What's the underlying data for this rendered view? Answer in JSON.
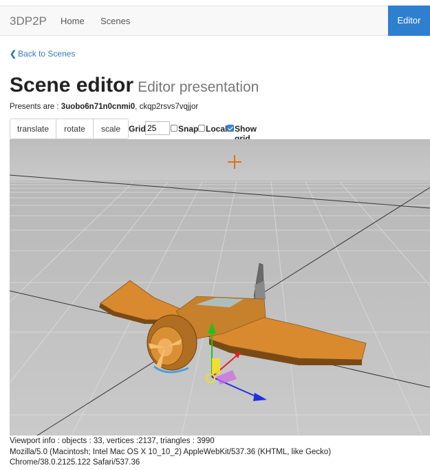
{
  "navbar": {
    "brand": "3DP2P",
    "links": [
      "Home",
      "Scenes"
    ],
    "active": "Editor",
    "colors": {
      "active_bg": "#2f7fd0"
    }
  },
  "back_link": {
    "icon": "chevron-left-icon",
    "label": "Back to Scenes"
  },
  "title": {
    "main": "Scene editor",
    "sub": "Editor presentation"
  },
  "presents": {
    "label": "Presents are : ",
    "items": [
      "3uobo6n71n0cnmi0",
      "ckqp2rsvs7vqjjor"
    ]
  },
  "toolbar": {
    "translate": "translate",
    "rotate": "rotate",
    "scale": "scale",
    "grid_label": "Grid",
    "grid_value": "25",
    "snap_label": "Snap",
    "snap_checked": false,
    "local_label": "Local",
    "local_checked": false,
    "show_grid_label": "Show grid",
    "show_grid_checked": true
  },
  "viewport": {
    "colors": {
      "background": "#c4c4c4",
      "plane": "#f0a040",
      "gizmo_x": "#e02020",
      "gizmo_y": "#20c020",
      "gizmo_z": "#2030e0"
    }
  },
  "footer": {
    "info": "Viewport info : objects : 33, vertices :2137, triangles : 3990",
    "ua_line1": "Mozilla/5.0 (Macintosh; Intel Mac OS X 10_10_2) AppleWebKit/537.36 (KHTML, like Gecko)",
    "ua_line2": "Chrome/38.0.2125.122 Safari/537.36"
  }
}
